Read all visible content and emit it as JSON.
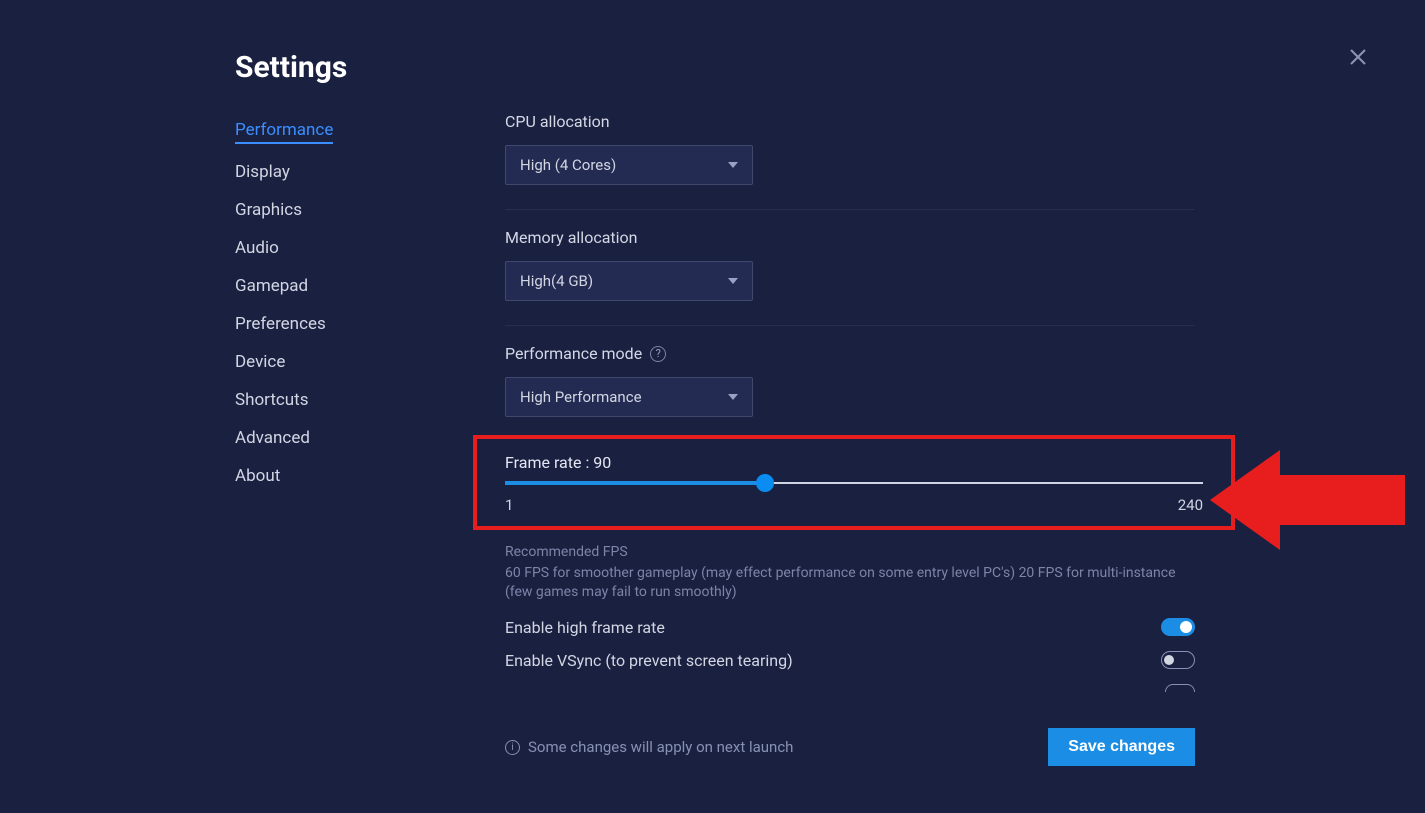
{
  "title": "Settings",
  "sidebar": {
    "items": [
      {
        "label": "Performance",
        "active": true
      },
      {
        "label": "Display"
      },
      {
        "label": "Graphics"
      },
      {
        "label": "Audio"
      },
      {
        "label": "Gamepad"
      },
      {
        "label": "Preferences"
      },
      {
        "label": "Device"
      },
      {
        "label": "Shortcuts"
      },
      {
        "label": "Advanced"
      },
      {
        "label": "About"
      }
    ]
  },
  "performance": {
    "cpu": {
      "label": "CPU allocation",
      "value": "High (4 Cores)"
    },
    "memory": {
      "label": "Memory allocation",
      "value": "High(4 GB)"
    },
    "mode": {
      "label": "Performance mode",
      "value": "High Performance"
    },
    "framerate": {
      "label_prefix": "Frame rate : ",
      "value": "90",
      "min": "1",
      "max": "240",
      "hint_title": "Recommended FPS",
      "hint_body": "60 FPS for smoother gameplay (may effect performance on some entry level PC's) 20 FPS for multi-instance (few games may fail to run smoothly)"
    },
    "toggle_highfps": {
      "label": "Enable high frame rate",
      "on": true
    },
    "toggle_vsync": {
      "label": "Enable VSync (to prevent screen tearing)",
      "on": false
    }
  },
  "footer": {
    "note": "Some changes will apply on next launch",
    "save": "Save changes"
  }
}
